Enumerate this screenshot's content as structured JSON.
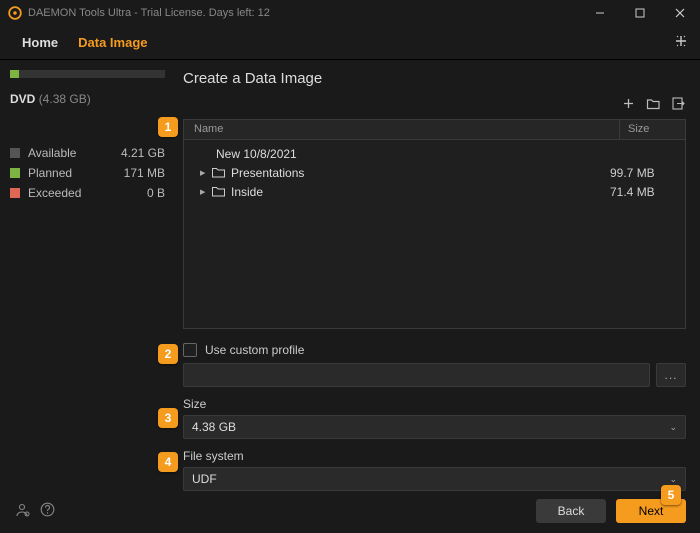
{
  "window": {
    "title": "DAEMON Tools Ultra - Trial License. Days left: 12"
  },
  "tabs": {
    "home": "Home",
    "data_image": "Data Image"
  },
  "sidebar": {
    "disc_type": "DVD",
    "disc_capacity": "(4.38 GB)",
    "legend": {
      "available_label": "Available",
      "available_value": "4.21 GB",
      "planned_label": "Planned",
      "planned_value": "171 MB",
      "exceeded_label": "Exceeded",
      "exceeded_value": "0 B"
    }
  },
  "page": {
    "title": "Create a Data Image",
    "columns": {
      "name": "Name",
      "size": "Size"
    },
    "rows": [
      {
        "name": "New 10/8/2021",
        "size": "",
        "root": true
      },
      {
        "name": "Presentations",
        "size": "99.7 MB",
        "root": false
      },
      {
        "name": "Inside",
        "size": "71.4 MB",
        "root": false
      }
    ],
    "custom_profile_label": "Use custom profile",
    "browse_label": "...",
    "size_label": "Size",
    "size_value": "4.38 GB",
    "fs_label": "File system",
    "fs_value": "UDF"
  },
  "buttons": {
    "back": "Back",
    "next": "Next"
  },
  "callouts": [
    "1",
    "2",
    "3",
    "4",
    "5"
  ]
}
